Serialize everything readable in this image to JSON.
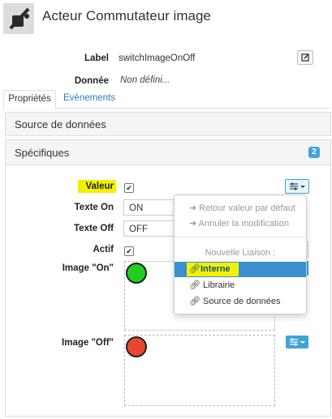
{
  "header": {
    "title": "Acteur Commutateur image",
    "icon": "image-switch-icon"
  },
  "meta": {
    "label_label": "Label",
    "label_value": "switchImageOnOff",
    "data_label": "Donnée",
    "data_value": "Non défini..."
  },
  "tabs": [
    {
      "label": "Propriétés"
    },
    {
      "label": "Evènements"
    }
  ],
  "sections": {
    "source_title": "Source de données",
    "specific_title": "Spécifiques",
    "specific_badge": "2"
  },
  "fields": {
    "valeur_label": "Valeur",
    "texte_on_label": "Texte On",
    "texte_on_value": "ON",
    "texte_off_label": "Texte Off",
    "texte_off_value": "OFF",
    "actif_label": "Actif",
    "image_on_label": "Image \"On\"",
    "image_off_label": "Image \"Off\"",
    "checkmark": "✔"
  },
  "dropdown": {
    "retour": "Retour valeur par défaut",
    "annuler": "Annuler la modification",
    "nouvelle": "Nouvelle Liaison :",
    "interne": "Interne",
    "librairie": "Librairie",
    "source": "Source de données"
  },
  "colors": {
    "on_dot": "#22cc22",
    "off_dot": "#e8472e",
    "highlight": "#f2f200",
    "accent": "#3fa5d5",
    "selected": "#3a8fd0"
  }
}
